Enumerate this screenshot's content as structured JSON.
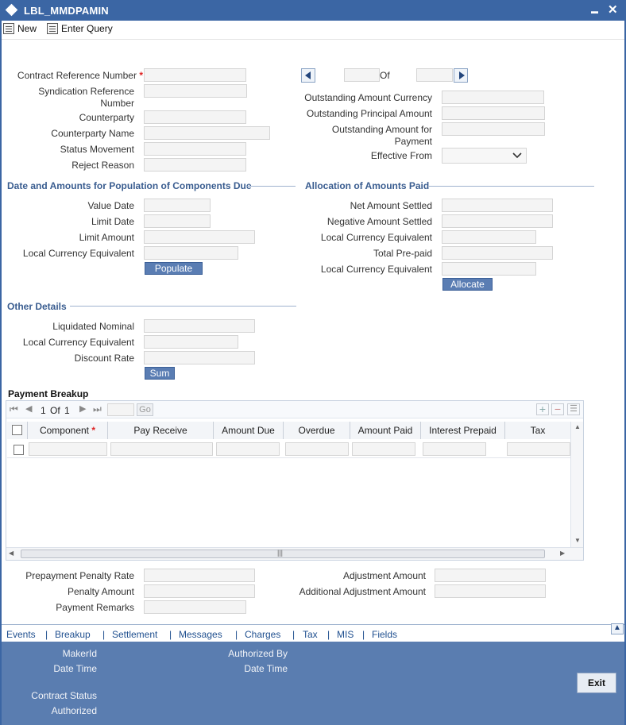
{
  "window": {
    "title": "LBL_MMDPAMIN",
    "minimize": "▬",
    "close": "✕"
  },
  "toolbar": {
    "new_label": "New",
    "enter_query_label": "Enter Query"
  },
  "header": {
    "contract_ref_label": "Contract Reference Number",
    "required_mark": "*",
    "syndication_ref_label_1": "Syndication Reference",
    "syndication_ref_label_2": "Number",
    "counterparty_label": "Counterparty",
    "counterparty_name_label": "Counterparty Name",
    "status_movement_label": "Status Movement",
    "reject_reason_label": "Reject Reason",
    "of_label": "Of",
    "outstanding_amount_currency_label": "Outstanding Amount Currency",
    "outstanding_principal_label": "Outstanding Principal Amount",
    "outstanding_payment_label_1": "Outstanding Amount for",
    "outstanding_payment_label_2": "Payment",
    "effective_from_label": "Effective From"
  },
  "components_due": {
    "section_title": "Date and Amounts for Population of Components Due",
    "value_date_label": "Value Date",
    "limit_date_label": "Limit Date",
    "limit_amount_label": "Limit Amount",
    "lce_label": "Local Currency Equivalent",
    "populate_label": "Populate"
  },
  "allocation": {
    "section_title": "Allocation of Amounts Paid",
    "net_amount_label": "Net Amount Settled",
    "negative_amount_label": "Negative Amount Settled",
    "lce_label": "Local Currency Equivalent",
    "total_prepaid_label": "Total Pre-paid",
    "lce2_label": "Local Currency Equivalent",
    "allocate_label": "Allocate"
  },
  "other": {
    "section_title": "Other Details",
    "liquidated_nominal_label": "Liquidated Nominal",
    "lce_label": "Local Currency Equivalent",
    "discount_rate_label": "Discount Rate",
    "sum_label": "Sum"
  },
  "payment_breakup": {
    "title": "Payment Breakup",
    "page_current": "1",
    "page_of": "Of",
    "page_total": "1",
    "go_label": "Go",
    "columns": [
      "Component",
      "Pay Receive",
      "Amount Due",
      "Overdue",
      "Amount Paid",
      "Interest Prepaid",
      "Tax"
    ],
    "hscroll_grip": "|||"
  },
  "penalty": {
    "prepayment_penalty_rate_label": "Prepayment Penalty Rate",
    "penalty_amount_label": "Penalty Amount",
    "payment_remarks_label": "Payment Remarks",
    "adjustment_amount_label": "Adjustment Amount",
    "additional_adjustment_label": "Additional Adjustment Amount"
  },
  "tabs": [
    "Events",
    "Breakup",
    "Settlement",
    "Messages",
    "Charges",
    "Tax",
    "MIS",
    "Fields"
  ],
  "tab_separator": "|",
  "footer": {
    "maker_id_label": "MakerId",
    "date_time_label": "Date Time",
    "authorized_by_label": "Authorized By",
    "date_time2_label": "Date Time",
    "contract_status_label": "Contract Status",
    "authorized_label": "Authorized",
    "exit_label": "Exit"
  }
}
